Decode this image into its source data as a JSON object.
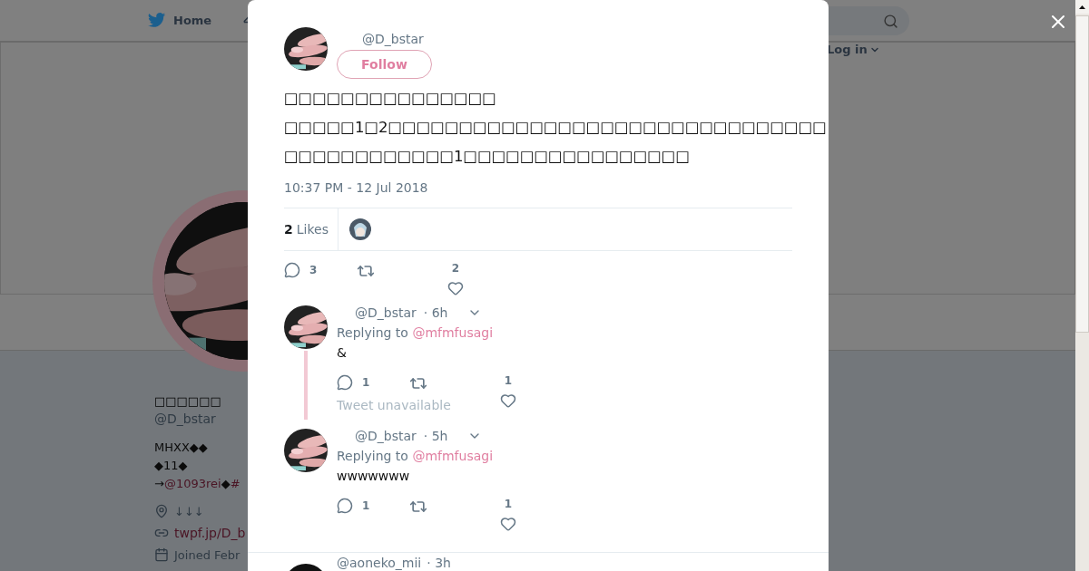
{
  "nav": {
    "home": "Home",
    "login": "Log in"
  },
  "profile": {
    "name": "□□□□□□",
    "handle": "@D_bstar",
    "bio": [
      "MHXX◆◆",
      "◆11◆"
    ],
    "bio_links": [
      {
        "text": "→",
        "link": false
      },
      {
        "text": "@1093rei",
        "link": true
      },
      {
        "text": "◆",
        "link": false
      },
      {
        "text": "#",
        "link": true
      }
    ],
    "location": "↓↓↓",
    "url": "twpf.jp/D_b",
    "joined": "Joined Febr"
  },
  "tweet": {
    "handle": "@D_bstar",
    "follow": "Follow",
    "text": "□□□□□□□□□□□□□□□\n□□□□□1□2□□□□□□□□□□□□□□□□□□□□□□□□□□□□□□□\n□□□□□□□□□□□□1□□□□□□□□□□□□□□□□",
    "time": "10:37 PM - 12 Jul 2018",
    "likes_count": "2",
    "likes_label": "Likes",
    "replies": "3",
    "likes": "2"
  },
  "replies": [
    {
      "handle": "@D_bstar",
      "time": "· 6h",
      "replying_label": "Replying to",
      "replying_to": "@mfmfusagi",
      "text": "&",
      "replies": "1",
      "likes": "1",
      "thread": true,
      "note": "Tweet unavailable"
    },
    {
      "handle": "@D_bstar",
      "time": "· 5h",
      "replying_label": "Replying to",
      "replying_to": "@mfmfusagi",
      "text": "wwwwwww",
      "replies": "1",
      "likes": "1",
      "thread": false
    }
  ],
  "next_reply": {
    "handle": "@aoneko_mii",
    "time": "· 3h"
  }
}
